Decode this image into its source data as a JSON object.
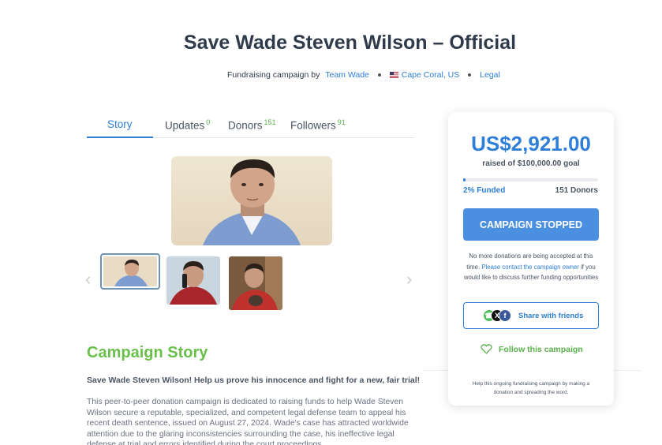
{
  "header": {
    "title": "Save Wade Steven Wilson – Official",
    "by_label": "Fundraising campaign by",
    "organizer": "Team Wade",
    "location": "Cape Coral, US",
    "category": "Legal"
  },
  "tabs": [
    {
      "label": "Story",
      "count": ""
    },
    {
      "label": "Updates",
      "count": "0"
    },
    {
      "label": "Donors",
      "count": "151"
    },
    {
      "label": "Followers",
      "count": "91"
    }
  ],
  "story": {
    "title": "Campaign Story",
    "lead": "Save Wade Steven Wilson! Help us prove his innocence and fight for a new, fair trial!",
    "body": "This peer-to-peer donation campaign is dedicated to raising funds to help Wade Steven Wilson secure a reputable, specialized, and competent legal defense team to appeal his recent death sentence, issued on August 27, 2024. Wade's case has attracted worldwide attention due to the glaring inconsistencies surrounding the case, his ineffective legal defense at trial and errors identified during the court proceedings."
  },
  "card": {
    "amount": "US$2,921.00",
    "goal_text": "raised of $100,000.00 goal",
    "progress_fraction": 0.02,
    "funded_label": "2% Funded",
    "donors_label": "151 Donors",
    "button_label": "CAMPAIGN STOPPED",
    "note_prefix": "No more donations are being accepted at this time.",
    "note_link": "Please contact the campaign owner",
    "note_suffix": "if you would like to discuss further funding opportunities",
    "share_label": "Share with friends",
    "share_icons": [
      "whatsapp-icon",
      "x-icon",
      "facebook-icon"
    ],
    "follow_label": "Follow this campaign",
    "help_text": "Help this ongoing fundraising campaign by making a donation and spreading the word."
  },
  "colors": {
    "accent": "#2f7fd8",
    "green": "#5ab04c",
    "button": "#4a8fe0"
  }
}
